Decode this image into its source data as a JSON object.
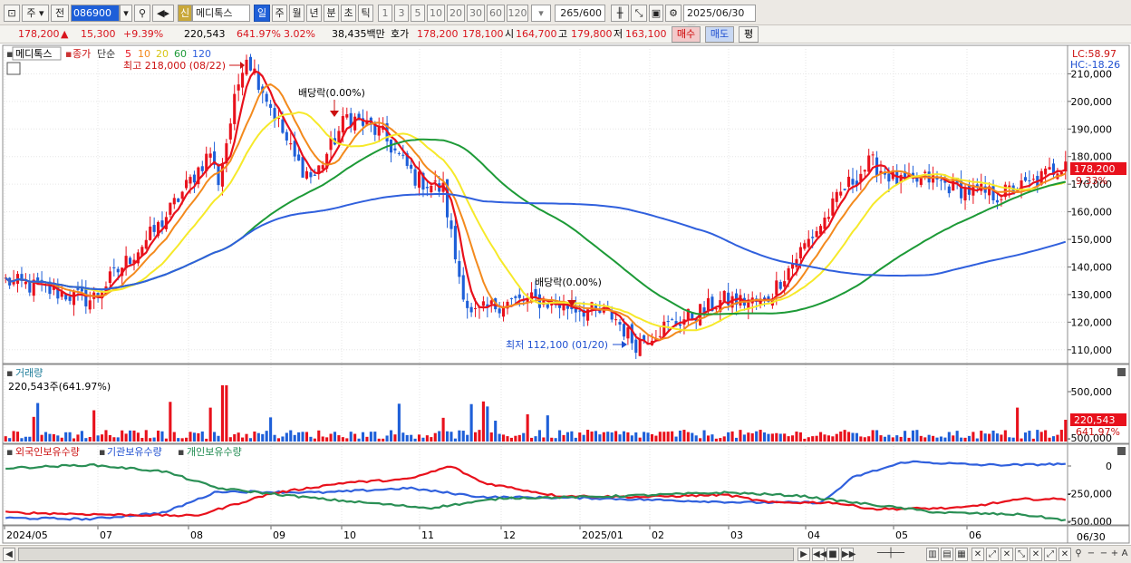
{
  "toolbar": {
    "mode_label": "주",
    "mode2_label": "전",
    "code": "086900",
    "badge": "신",
    "stock_name": "메디톡스",
    "period_active": "일",
    "periods": [
      "주",
      "월",
      "년",
      "분",
      "초",
      "틱"
    ],
    "minutes": [
      "1",
      "3",
      "5",
      "10",
      "20",
      "30",
      "60",
      "120"
    ],
    "count": "265",
    "count_total": "/600",
    "date": "2025/06/30"
  },
  "quote": {
    "price": "178,200",
    "arrow": "▲",
    "change": "15,300",
    "change_pct": "+9.39%",
    "volume": "220,543",
    "volume_ratio": "641.97%",
    "turnover": "3.02%",
    "amount": "38,435백만",
    "hoga_label": "호가",
    "ask": "178,200",
    "bid": "178,100",
    "open_label": "시",
    "open": "164,700",
    "high_label": "고",
    "high": "179,800",
    "low_label": "저",
    "low": "163,100",
    "buy_label": "매수",
    "sell_label": "매도",
    "avg_label": "평"
  },
  "price_panel": {
    "legend_name": "메디톡스",
    "legend_close": "종가",
    "legend_ma": "단순",
    "ma_periods": [
      "5",
      "10",
      "20",
      "60",
      "120"
    ],
    "lc": "LC:58.97",
    "hc": "HC:-18.26",
    "max_label": "최고 218,000 (08/22)",
    "min_label": "최저 112,100 (01/20)",
    "dividend1": "배당락(0.00%)",
    "dividend2": "배당락(0.00%)",
    "last_price": "178,200",
    "last_pct": "9.33%"
  },
  "volume_panel": {
    "title": "거래량",
    "value": "220,543주(641.97%)",
    "last_value": "220,543",
    "last_pct": "641.97%"
  },
  "holdings_panel": {
    "series": [
      "외국인보유수량",
      "기관보유수량",
      "개인보유수량"
    ]
  },
  "bottom": {
    "date_label": "06/30"
  },
  "colors": {
    "candle_up": "#e8111c",
    "candle_down": "#1e5fd8",
    "ma5": "#e8111c",
    "ma10": "#f38a1d",
    "ma20": "#f6e92a",
    "ma60": "#1d9a37",
    "ma120": "#3060dd",
    "foreign": "#3060dd",
    "institution": "#e8111c",
    "individual": "#2a8f55"
  },
  "chart_data": [
    {
      "type": "candlestick",
      "x_ticks": [
        "2024/05",
        "07",
        "08",
        "09",
        "10",
        "11",
        "12",
        "2025/01",
        "02",
        "03",
        "04",
        "05",
        "06"
      ],
      "y_ticks": [
        "110,000",
        "120,000",
        "130,000",
        "140,000",
        "150,000",
        "160,000",
        "170,000",
        "180,000",
        "190,000",
        "200,000",
        "210,000"
      ],
      "ylim": [
        105000,
        219000
      ],
      "control_points_close": [
        [
          "2024/05",
          135000
        ],
        [
          "06",
          128000
        ],
        [
          "07",
          155000
        ],
        [
          "08",
          185000
        ],
        [
          "08/22",
          218000
        ],
        [
          "09",
          180000
        ],
        [
          "10",
          195000
        ],
        [
          "11",
          165000
        ],
        [
          "11/20",
          122000
        ],
        [
          "12",
          127000
        ],
        [
          "2025/01",
          125000
        ],
        [
          "01/20",
          112100
        ],
        [
          "02",
          120000
        ],
        [
          "03",
          125000
        ],
        [
          "04",
          140000
        ],
        [
          "05",
          178000
        ],
        [
          "06",
          170000
        ],
        [
          "06/30",
          178200
        ]
      ],
      "moving_averages": [
        "5",
        "10",
        "20",
        "60",
        "120"
      ]
    },
    {
      "type": "bar",
      "title": "거래량",
      "y_ticks": [
        "500,000",
        "-500,000"
      ],
      "last_value": 220543
    },
    {
      "type": "line",
      "y_ticks": [
        "0",
        "-250,000",
        "-500,000"
      ],
      "series": [
        {
          "name": "외국인보유수량"
        },
        {
          "name": "기관보유수량"
        },
        {
          "name": "개인보유수량"
        }
      ]
    }
  ]
}
